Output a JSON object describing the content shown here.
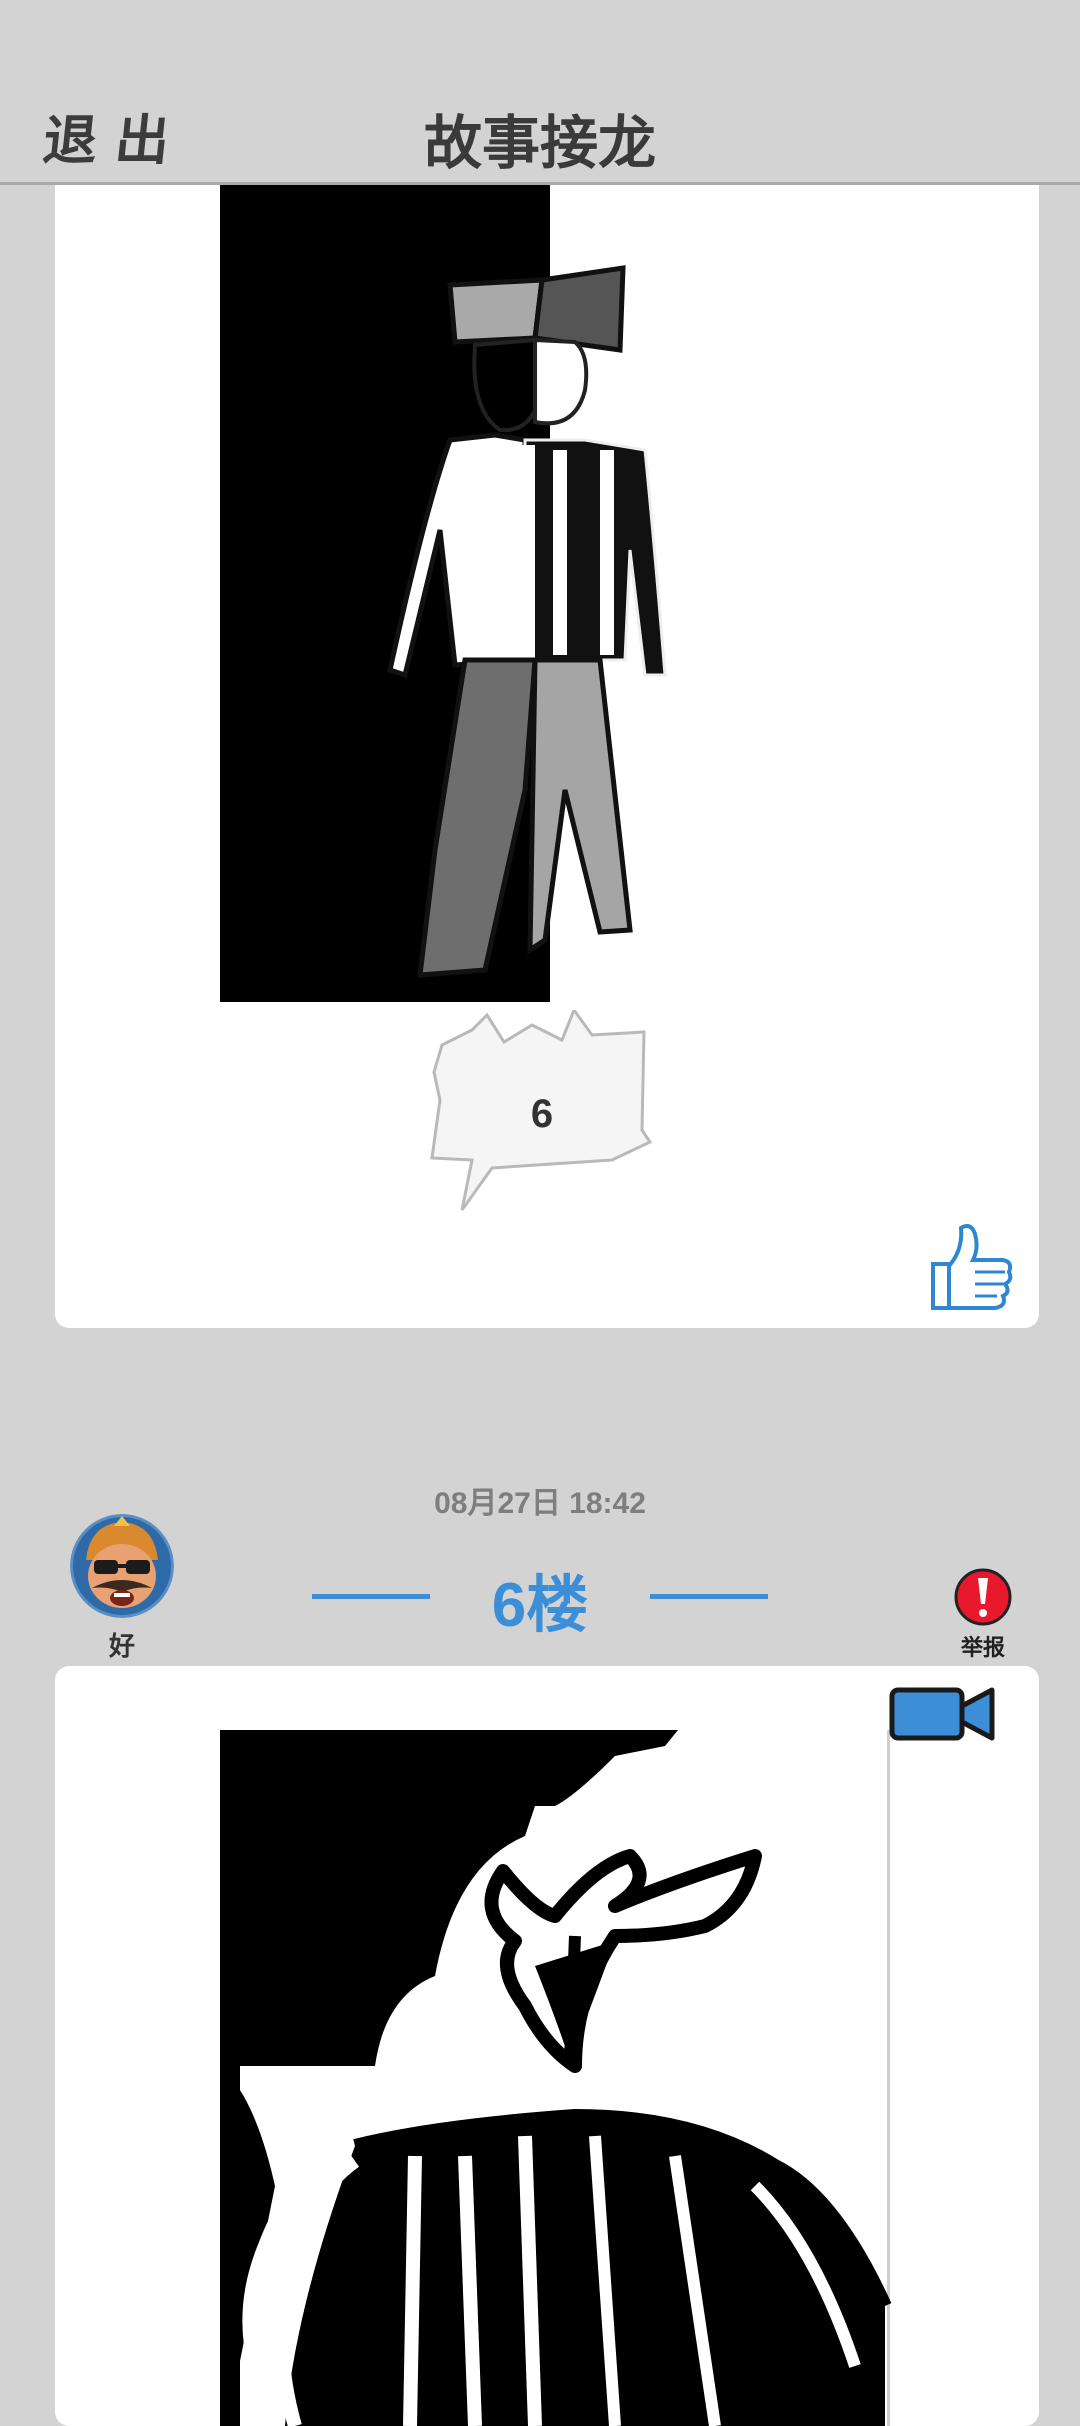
{
  "header": {
    "exit_label": "退出",
    "title": "故事接龙"
  },
  "post_previous": {
    "bubble_text": "6",
    "like_icon": "thumbs-up-icon"
  },
  "post_current": {
    "timestamp": "08月27日  18:42",
    "floor_label": "6楼",
    "username": "好",
    "report_label": "举报",
    "report_icon": "exclamation-icon",
    "video_icon": "video-camera-icon"
  },
  "colors": {
    "background": "#d3d3d3",
    "accent_blue": "#3c8fd6",
    "report_red": "#e8192c",
    "card_white": "#ffffff"
  }
}
